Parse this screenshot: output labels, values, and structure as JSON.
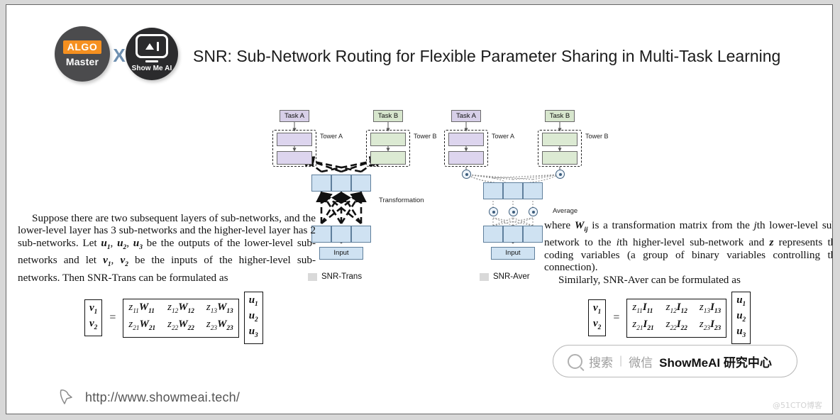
{
  "header": {
    "logo_algo_top": "ALGO",
    "logo_algo_bottom": "Master",
    "logo_x": "X",
    "logo_showmeai_text": "Show Me AI",
    "title": "SNR: Sub-Network Routing for Flexible Parameter Sharing in Multi-Task Learning"
  },
  "diagram_trans": {
    "task_a": "Task A",
    "task_b": "Task B",
    "tower_a": "Tower A",
    "tower_b": "Tower B",
    "middle_label": "Transformation",
    "input": "Input",
    "legend": "SNR-Trans"
  },
  "diagram_aver": {
    "task_a": "Task A",
    "task_b": "Task B",
    "tower_a": "Tower A",
    "tower_b": "Tower B",
    "middle_label": "Average",
    "input": "Input",
    "legend": "SNR-Aver"
  },
  "text": {
    "left_p1_a": "Suppose there are two subsequent layers of sub-networks, and the lower-level layer has 3 sub-networks and the higher-level layer has 2 sub-networks. Let ",
    "left_u1": "u",
    "left_u1_sub": "1",
    "left_u2": "u",
    "left_u2_sub": "2",
    "left_u3": "u",
    "left_u3_sub": "3",
    "left_p1_b": " be the outputs of the lower-level sub-networks and let ",
    "left_v1": "v",
    "left_v1_sub": "1",
    "left_v2": "v",
    "left_v2_sub": "2",
    "left_p1_c": " be the inputs of the higher-level sub-networks. Then SNR-Trans can be formulated as",
    "right_p1_a": "where ",
    "right_W": "W",
    "right_W_sub": "ij",
    "right_p1_b": " is a transformation matrix from the ",
    "right_j": "j",
    "right_p1_c": "th lower-level sub-network to the ",
    "right_i": "i",
    "right_p1_d": "th higher-level sub-network and ",
    "right_z": "z",
    "right_p1_e": " represents the coding variables (a group of binary variables controlling the connection).",
    "right_p2": "Similarly, SNR-Aver can be formulated as"
  },
  "equation_left": {
    "lhs": [
      "v1",
      "v2"
    ],
    "matrix": [
      [
        "z11W11",
        "z12W12",
        "z13W13"
      ],
      [
        "z21W21",
        "z22W22",
        "z23W23"
      ]
    ],
    "rhs": [
      "u1",
      "u2",
      "u3"
    ],
    "sign": "="
  },
  "equation_right": {
    "lhs": [
      "v1",
      "v2"
    ],
    "matrix": [
      [
        "z11I11",
        "z12I12",
        "z13I13"
      ],
      [
        "z21I21",
        "z22I22",
        "z23I23"
      ]
    ],
    "rhs": [
      "u1",
      "u2",
      "u3"
    ],
    "sign": "="
  },
  "search_pill": {
    "placeholder": "搜索",
    "divider": "|",
    "channel": "微信",
    "brand": "ShowMeAI 研究中心"
  },
  "footer": {
    "url": "http://www.showmeai.tech/",
    "watermark": "@51CTO博客"
  },
  "colors": {
    "task_a_fill": "#d7cfe8",
    "task_b_fill": "#d7e6cd",
    "subnet_fill": "#cfe2f2",
    "subnet_stroke": "#5f7f9c",
    "accent_orange": "#f59020",
    "logo_grey": "#4b4b4d",
    "logo_dark": "#2b2b2d"
  }
}
